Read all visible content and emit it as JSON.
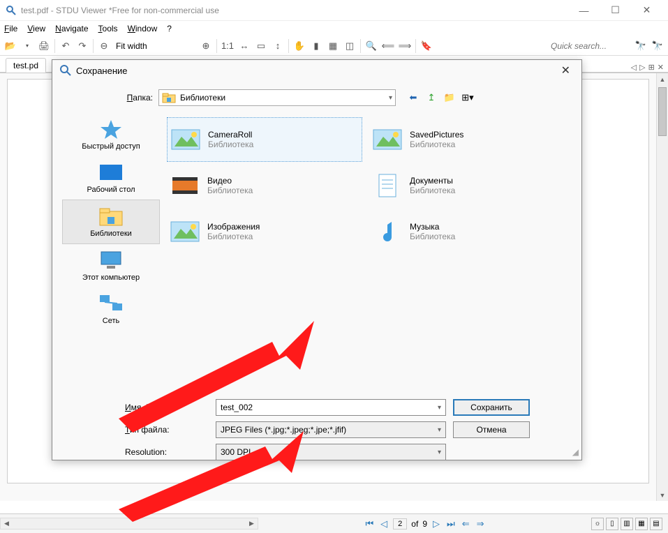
{
  "window": {
    "title": "test.pdf - STDU Viewer *Free for non-commercial use"
  },
  "menu": {
    "file": "File",
    "view": "View",
    "navigate": "Navigate",
    "tools": "Tools",
    "window": "Window",
    "help": "?"
  },
  "toolbar": {
    "fit_mode": "Fit width",
    "quick_search_placeholder": "Quick search..."
  },
  "tabs": {
    "doc1": "test.pd"
  },
  "pager": {
    "current": "2",
    "label_of": "of",
    "total": "9"
  },
  "dialog": {
    "title": "Сохранение",
    "folder_label": "Папка:",
    "folder_value": "Библиотеки",
    "places": {
      "quick": "Быстрый доступ",
      "desktop": "Рабочий стол",
      "libraries": "Библиотеки",
      "computer": "Этот компьютер",
      "network": "Сеть"
    },
    "libs": {
      "camera": {
        "name": "CameraRoll",
        "sub": "Библиотека"
      },
      "saved": {
        "name": "SavedPictures",
        "sub": "Библиотека"
      },
      "video": {
        "name": "Видео",
        "sub": "Библиотека"
      },
      "docs": {
        "name": "Документы",
        "sub": "Библиотека"
      },
      "images": {
        "name": "Изображения",
        "sub": "Библиотека"
      },
      "music": {
        "name": "Музыка",
        "sub": "Библиотека"
      }
    },
    "filename_label": "Имя файла:",
    "filename_value": "test_002",
    "filetype_label": "Тип файла:",
    "filetype_value": "JPEG Files (*.jpg;*.jpeg;*.jpe;*.jfif)",
    "resolution_label": "Resolution:",
    "resolution_value": "300 DPI",
    "save_btn": "Сохранить",
    "cancel_btn": "Отмена"
  }
}
